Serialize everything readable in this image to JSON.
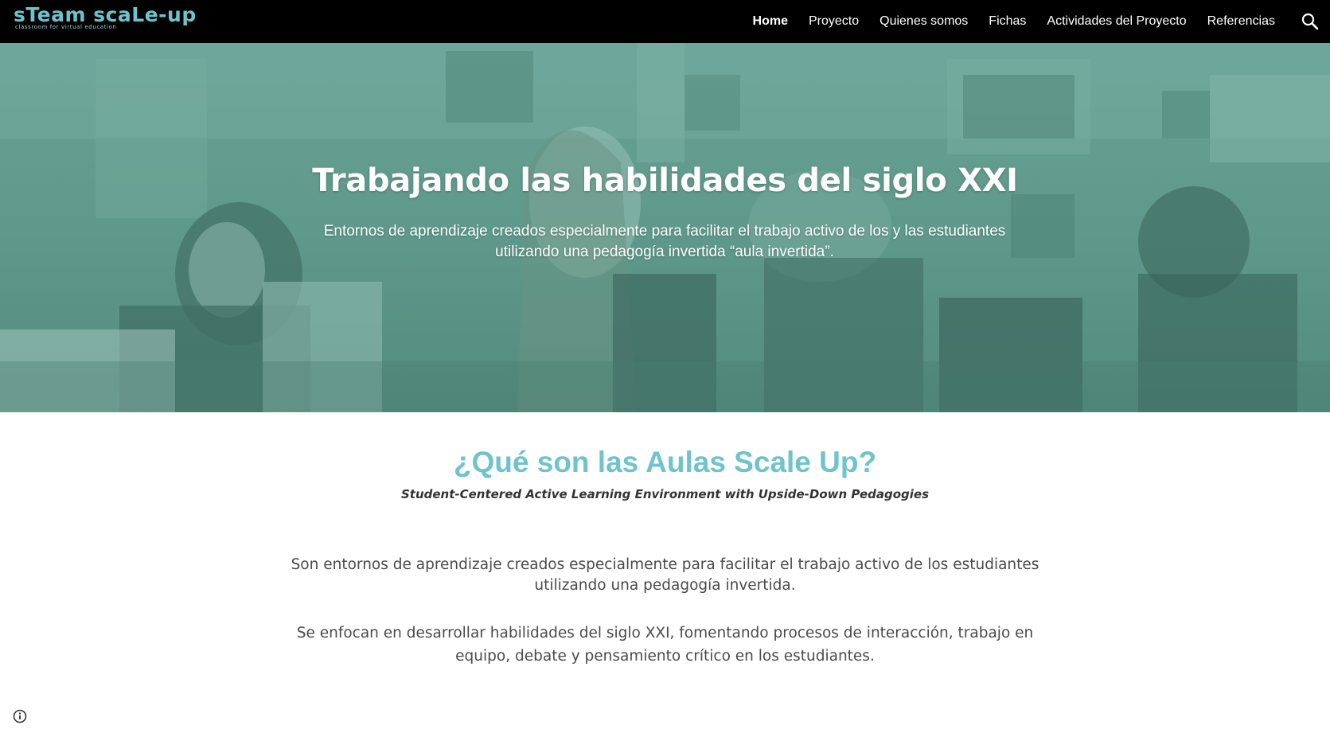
{
  "header": {
    "logo": {
      "title": "sTeam scaLe-up",
      "tagline": "classroom for virtual education"
    },
    "nav": [
      {
        "label": "Home",
        "active": true
      },
      {
        "label": "Proyecto",
        "active": false
      },
      {
        "label": "Quienes somos",
        "active": false
      },
      {
        "label": "Fichas",
        "active": false
      },
      {
        "label": "Actividades del Proyecto",
        "active": false
      },
      {
        "label": "Referencias",
        "active": false
      }
    ],
    "search_icon": "search-icon"
  },
  "hero": {
    "title": "Trabajando las habilidades del siglo XXI",
    "subtitle": "Entornos de aprendizaje creados especialmente para facilitar el trabajo activo de los y las estudiantes utilizando una pedagogía invertida “aula invertida”.",
    "overlay_color": "#5e9789"
  },
  "main": {
    "title": "¿Qué son las Aulas Scale Up?",
    "tagline": "Student-Centered Active Learning Environment with Upside-Down Pedagogies",
    "paragraphs": [
      "Son entornos de aprendizaje creados especialmente para facilitar el trabajo activo de los estudiantes utilizando una pedagogía invertida.",
      "Se enfocan en desarrollar habilidades del siglo XXI, fomentando procesos de interacción, trabajo en equipo, debate y pensamiento crítico en los estudiantes."
    ]
  },
  "footer": {
    "info_icon": "info-icon"
  },
  "colors": {
    "accent": "#6ec3cc",
    "nav_bg": "#000000",
    "text": "#4a4a4a"
  }
}
